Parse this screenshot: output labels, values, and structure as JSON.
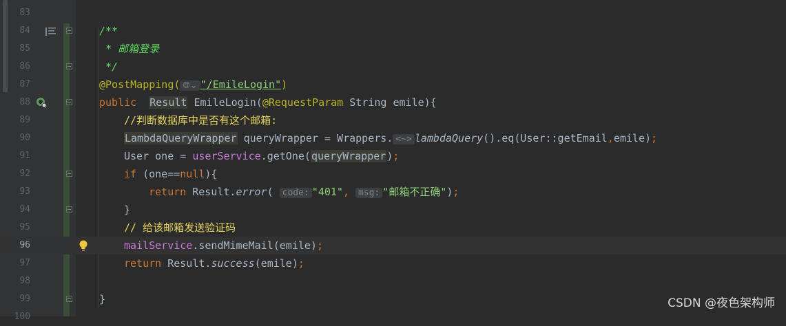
{
  "editor": {
    "lines": [
      {
        "n": "83",
        "segments": []
      },
      {
        "n": "84",
        "segments": [
          {
            "t": "/**",
            "c": "cmt-green"
          }
        ]
      },
      {
        "n": "85",
        "segments": [
          {
            "t": " * 邮箱登录",
            "c": "cmt-green"
          }
        ]
      },
      {
        "n": "86",
        "segments": [
          {
            "t": " */",
            "c": "cmt-green"
          }
        ]
      },
      {
        "n": "87",
        "segments": [
          {
            "t": "@PostMapping(",
            "c": "ann"
          },
          {
            "t": "🌐︎⌄",
            "c": "hint-globe"
          },
          {
            "t": "\"/EmileLogin\"",
            "c": "str-bright underline"
          },
          {
            "t": ")",
            "c": "ann"
          }
        ]
      },
      {
        "n": "88",
        "segments": [
          {
            "t": "public",
            "c": "kw"
          },
          {
            "t": "  "
          },
          {
            "t": "Result",
            "c": "hl"
          },
          {
            "t": " EmileLogin("
          },
          {
            "t": "@RequestParam",
            "c": "ann"
          },
          {
            "t": " String emile){"
          }
        ]
      },
      {
        "n": "89",
        "indent": 1,
        "segments": [
          {
            "t": "//判断数据库中是否有这个邮箱:",
            "c": "cmt-yellow"
          }
        ]
      },
      {
        "n": "90",
        "indent": 1,
        "segments": [
          {
            "t": "LambdaQueryWrapper",
            "c": "hl"
          },
          {
            "t": " queryWrapper = Wrappers."
          },
          {
            "t": "<~>",
            "c": "hint"
          },
          {
            "t": "lambdaQuery",
            "c": "italic"
          },
          {
            "t": "().eq(User::getEmail"
          },
          {
            "t": ",",
            "c": "kw"
          },
          {
            "t": "emile)"
          },
          {
            "t": ";",
            "c": "kw"
          }
        ]
      },
      {
        "n": "91",
        "indent": 1,
        "segments": [
          {
            "t": "User one = "
          },
          {
            "t": "userService",
            "c": "purple"
          },
          {
            "t": ".getOne("
          },
          {
            "t": "queryWrapper",
            "c": "hl"
          },
          {
            "t": ")"
          },
          {
            "t": ";",
            "c": "kw"
          }
        ]
      },
      {
        "n": "92",
        "indent": 1,
        "segments": [
          {
            "t": "if",
            "c": "kw"
          },
          {
            "t": " (one=="
          },
          {
            "t": "null",
            "c": "kw"
          },
          {
            "t": "){"
          }
        ]
      },
      {
        "n": "93",
        "indent": 2,
        "segments": [
          {
            "t": "return",
            "c": "kw"
          },
          {
            "t": " Result."
          },
          {
            "t": "error",
            "c": "italic"
          },
          {
            "t": "( "
          },
          {
            "t": "code:",
            "c": "hint"
          },
          {
            "t": "\"401\"",
            "c": "str-bright"
          },
          {
            "t": ",",
            "c": "kw"
          },
          {
            "t": " "
          },
          {
            "t": "msg:",
            "c": "hint"
          },
          {
            "t": "\"邮箱不正确\"",
            "c": "str-bright"
          },
          {
            "t": ")"
          },
          {
            "t": ";",
            "c": "kw"
          }
        ]
      },
      {
        "n": "94",
        "indent": 1,
        "segments": [
          {
            "t": "}"
          }
        ]
      },
      {
        "n": "95",
        "indent": 1,
        "segments": [
          {
            "t": "// 给该邮箱发送验证码",
            "c": "cmt-yellow"
          }
        ]
      },
      {
        "n": "96",
        "indent": 1,
        "current": true,
        "segments": [
          {
            "t": "mailService",
            "c": "purple"
          },
          {
            "t": ".sendMimeMail(emile)"
          },
          {
            "t": ";",
            "c": "kw"
          }
        ]
      },
      {
        "n": "97",
        "indent": 1,
        "segments": [
          {
            "t": "return",
            "c": "kw"
          },
          {
            "t": " Result."
          },
          {
            "t": "success",
            "c": "italic"
          },
          {
            "t": "(emile)"
          },
          {
            "t": ";",
            "c": "kw"
          }
        ]
      },
      {
        "n": "98",
        "segments": []
      },
      {
        "n": "99",
        "segments": [
          {
            "t": "}"
          }
        ]
      },
      {
        "n": "100",
        "segments": []
      }
    ],
    "fold_markers": [
      "84",
      "86",
      "88",
      "92",
      "94",
      "99"
    ],
    "gutter_icons": {
      "84": "bookmark-icon",
      "88": "bean-mapping-icon",
      "96": "lightbulb-icon"
    }
  },
  "watermark": "CSDN @夜色架构师",
  "colors": {
    "background": "#2b2b2b",
    "keyword": "#cc7832",
    "annotation": "#bbb529",
    "string": "#8fd17a",
    "doc_comment": "#5fd85f",
    "line_comment": "#e6d45c",
    "field": "#c67bd7"
  }
}
